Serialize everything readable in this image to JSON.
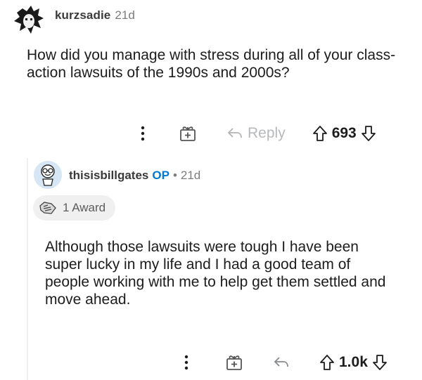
{
  "comment": {
    "username": "kurzsadie",
    "timestamp": "21d",
    "body": "How did you manage with stress during all of your class-action lawsuits of the 1990s and 2000s?",
    "actions": {
      "reply_label": "Reply",
      "vote_count": "693"
    }
  },
  "reply": {
    "username": "thisisbillgates",
    "op_badge": "OP",
    "separator": "•",
    "timestamp": "21d",
    "award_label": "1 Award",
    "body": "Although those lawsuits were tough I have been super lucky in my life and I had a good team of people working with me to help get them settled and move ahead.",
    "actions": {
      "vote_count": "1.0k"
    }
  },
  "icons": [
    "more-options-icon",
    "gift-award-icon",
    "reply-arrow-icon",
    "upvote-icon",
    "downvote-icon"
  ],
  "colors": {
    "text": "#1c1c1c",
    "muted": "#7c7c7c",
    "op_blue": "#0079d3",
    "icon_grey": "#878a8c",
    "award_bg": "#f0f0f0"
  }
}
